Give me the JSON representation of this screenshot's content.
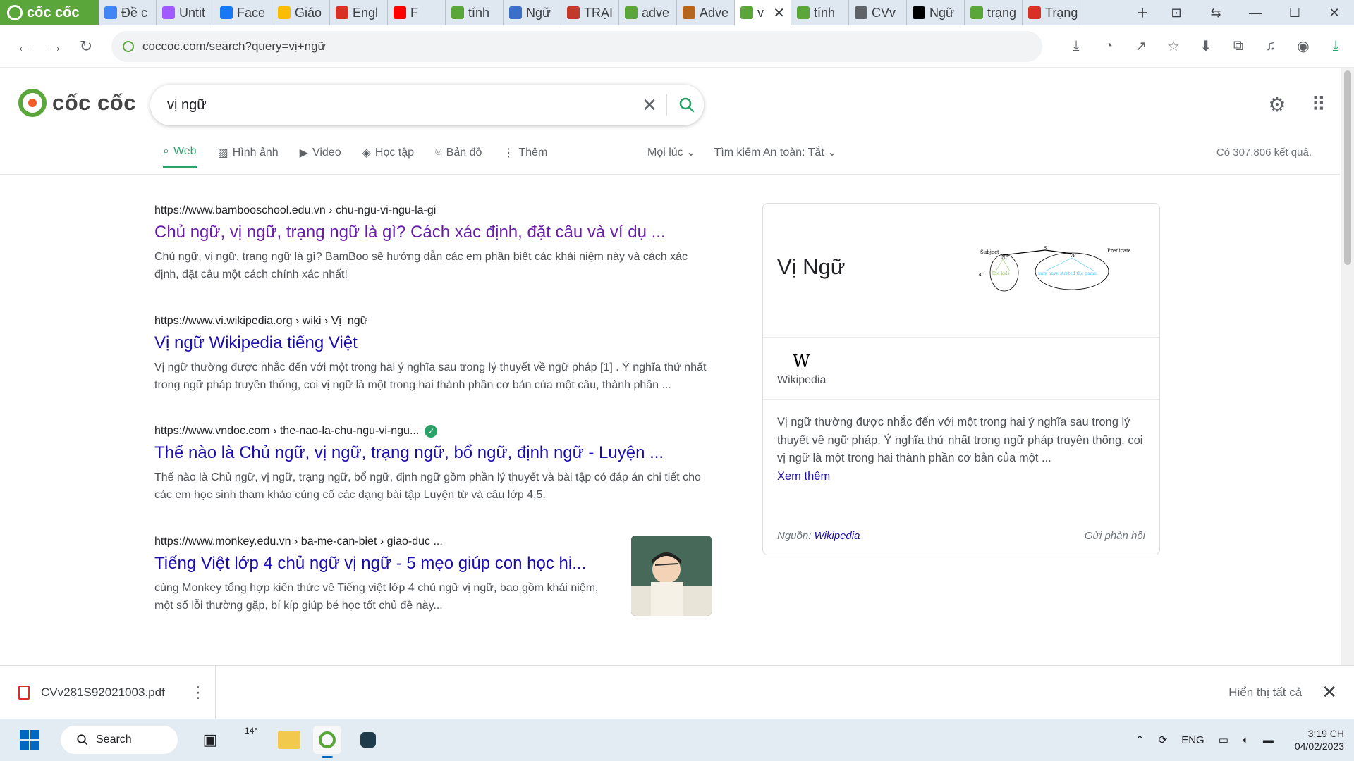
{
  "browser": {
    "brand": "cốc cốc",
    "tabs": [
      {
        "label": "Đề c",
        "icon": "docs-icon",
        "color": "#4285f4"
      },
      {
        "label": "Untit",
        "icon": "figma-icon",
        "color": "#a259ff"
      },
      {
        "label": "Face",
        "icon": "facebook-icon",
        "color": "#1877f2"
      },
      {
        "label": "Giáo",
        "icon": "drive-icon",
        "color": "#fbbc04"
      },
      {
        "label": "Engl",
        "icon": "app-icon",
        "color": "#d93025"
      },
      {
        "label": "F",
        "icon": "youtube-icon",
        "color": "#ff0000"
      },
      {
        "label": "tính",
        "icon": "coccoc-icon",
        "color": "#5aa63a"
      },
      {
        "label": "Ngữ",
        "icon": "app-icon",
        "color": "#3c6fc7"
      },
      {
        "label": "TRẠI",
        "icon": "app-icon",
        "color": "#c0392b"
      },
      {
        "label": "adve",
        "icon": "coccoc-icon",
        "color": "#5aa63a"
      },
      {
        "label": "Adve",
        "icon": "cambridge-icon",
        "color": "#b5651d"
      },
      {
        "label": "v",
        "icon": "coccoc-icon",
        "color": "#5aa63a",
        "active": true
      },
      {
        "label": "tính",
        "icon": "coccoc-icon",
        "color": "#5aa63a"
      },
      {
        "label": "CVv",
        "icon": "globe-icon",
        "color": "#5f6368"
      },
      {
        "label": "Ngữ",
        "icon": "wikipedia-icon",
        "color": "#000000"
      },
      {
        "label": "trạng",
        "icon": "coccoc-icon",
        "color": "#5aa63a"
      },
      {
        "label": "Trạng",
        "icon": "app-icon",
        "color": "#d93025"
      }
    ],
    "url": "coccoc.com/search?query=vị+ngữ"
  },
  "search": {
    "query": "vị ngữ",
    "nav": [
      {
        "label": "Web",
        "icon": "search-icon"
      },
      {
        "label": "Hình ảnh",
        "icon": "image-icon"
      },
      {
        "label": "Video",
        "icon": "video-icon"
      },
      {
        "label": "Học tập",
        "icon": "graduation-icon"
      },
      {
        "label": "Bản đồ",
        "icon": "map-pin-icon"
      },
      {
        "label": "Thêm",
        "icon": "more-vertical-icon"
      }
    ],
    "time_filter": "Mọi lúc",
    "safe_search_label": "Tìm kiếm An toàn:",
    "safe_search_value": "Tắt",
    "result_count": "Có 307.806 kết quả."
  },
  "results": [
    {
      "url_domain": "https://www.bambooschool.edu.vn",
      "url_path": " › chu-ngu-vi-ngu-la-gi",
      "title": "Chủ ngữ, vị ngữ, trạng ngữ là gì? Cách xác định, đặt câu và ví dụ ...",
      "snippet": "Chủ ngữ, vị ngữ, trạng ngữ là gì? BamBoo sẽ hướng dẫn các em phân biệt các khái niệm này và cách xác định, đặt câu một cách chính xác nhất!",
      "visited": true
    },
    {
      "url_domain": "https://www.vi.wikipedia.org",
      "url_path": " › wiki › Vị_ngữ",
      "title": "Vị ngữ Wikipedia tiếng Việt",
      "snippet": "Vị ngữ thường được nhắc đến với một trong hai ý nghĩa sau trong lý thuyết về ngữ pháp [1] . Ý nghĩa thứ nhất trong ngữ pháp truyền thống, coi vị ngữ là một trong hai thành phần cơ bản của một câu, thành phần ...",
      "visited": false
    },
    {
      "url_domain": "https://www.vndoc.com",
      "url_path": " › the-nao-la-chu-ngu-vi-ngu...",
      "title": "Thế nào là Chủ ngữ, vị ngữ, trạng ngữ, bổ ngữ, định ngữ - Luyện ...",
      "snippet": "Thế nào là Chủ ngữ, vị ngữ, trạng ngữ, bổ ngữ, định ngữ gồm phần lý thuyết và bài tập có đáp án chi tiết cho các em học sinh tham khảo củng cố các dạng bài tập Luyện từ và câu lớp 4,5.",
      "visited": false,
      "verified": true
    },
    {
      "url_domain": "https://www.monkey.edu.vn",
      "url_path": " › ba-me-can-biet › giao-duc ...",
      "title": "Tiếng Việt lớp 4 chủ ngữ vị ngữ - 5 mẹo giúp con học hi...",
      "snippet": "cùng Monkey tổng hợp kiến thức về Tiếng việt lớp 4 chủ ngữ vị ngữ, bao gồm khái niệm, một số lỗi thường gặp, bí kíp giúp bé học tốt chủ đề này...",
      "visited": false,
      "thumbnail": true
    }
  ],
  "knowledge_panel": {
    "title": "Vị Ngữ",
    "diagram": {
      "subject": "Subject",
      "predicate": "Predicate",
      "s": "S",
      "np": "NP",
      "vp": "VP",
      "a": "a.",
      "words_np": "The  kids",
      "words_vp": "may  have  started  the  game."
    },
    "source_logo": "W",
    "source_name": "Wikipedia",
    "description": "Vị ngữ thường được nhắc đến với một trong hai ý nghĩa sau trong lý thuyết về ngữ pháp. Ý nghĩa thứ nhất trong ngữ pháp truyền thống, coi vị ngữ là một trong hai thành phần cơ bản của một ...",
    "more": "Xem thêm",
    "footer_source_label": "Nguồn:",
    "footer_source_link": "Wikipedia",
    "feedback": "Gửi phản hồi"
  },
  "downloads": {
    "file": "CVv281S92021003.pdf",
    "show_all": "Hiển thị tất cả"
  },
  "taskbar": {
    "search": "Search",
    "weather": "14°",
    "lang": "ENG",
    "time": "3:19 CH",
    "date": "04/02/2023"
  }
}
